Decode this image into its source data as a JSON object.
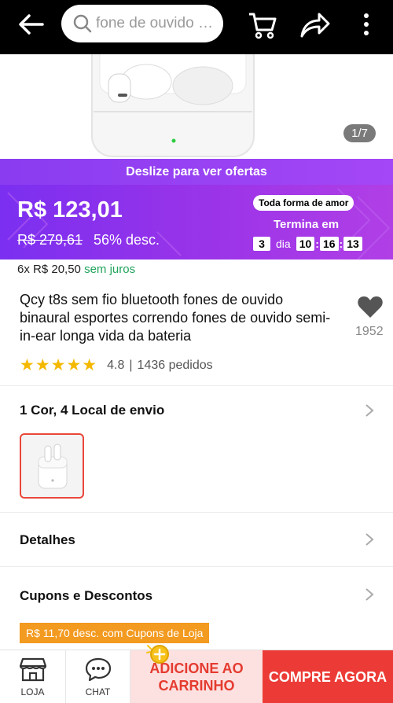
{
  "header": {
    "search_placeholder": "fone de ouvido b...",
    "icons": [
      "back-arrow-icon",
      "search-icon",
      "cart-icon",
      "share-icon",
      "more-vertical-icon"
    ]
  },
  "gallery": {
    "counter": "1/7"
  },
  "offer": {
    "swipe_label": "Deslize para ver ofertas",
    "price": "R$ 123,01",
    "old_price": "R$ 279,61",
    "discount": "56% desc.",
    "campaign_tag": "Toda forma de amor",
    "ends_label": "Termina em",
    "days": "3",
    "days_label": "dia",
    "hours": "10",
    "minutes": "16",
    "seconds": "13"
  },
  "installment": {
    "text": "6x R$ 20,50",
    "free_label": "sem juros"
  },
  "product": {
    "title": "Qcy t8s sem fio bluetooth fones de ouvido binaural esportes correndo fones de ouvido semi-in-ear longa vida da bateria",
    "wishlist_count": "1952",
    "rating_value": "4.8",
    "orders": "1436 pedidos",
    "stars": 5
  },
  "sections": {
    "variants_label": "1 Cor, 4 Local de envio",
    "details_label": "Detalhes",
    "coupons_label": "Cupons e Descontos",
    "coupon_badge": "R$ 11,70 desc. com Cupons de Loja"
  },
  "bottom_bar": {
    "store_label": "LOJA",
    "chat_label": "CHAT",
    "add_to_cart_line1": "ADICIONE AO",
    "add_to_cart_line2": "CARRINHO",
    "buy_now_label": "COMPRE AGORA"
  },
  "colors": {
    "header_bg": "#000000",
    "offer_purple": "#8a3cf0",
    "accent_red": "#ec3b36",
    "coupon_orange": "#f39a20",
    "star_yellow": "#f5b800",
    "free_green": "#1fa35b"
  }
}
